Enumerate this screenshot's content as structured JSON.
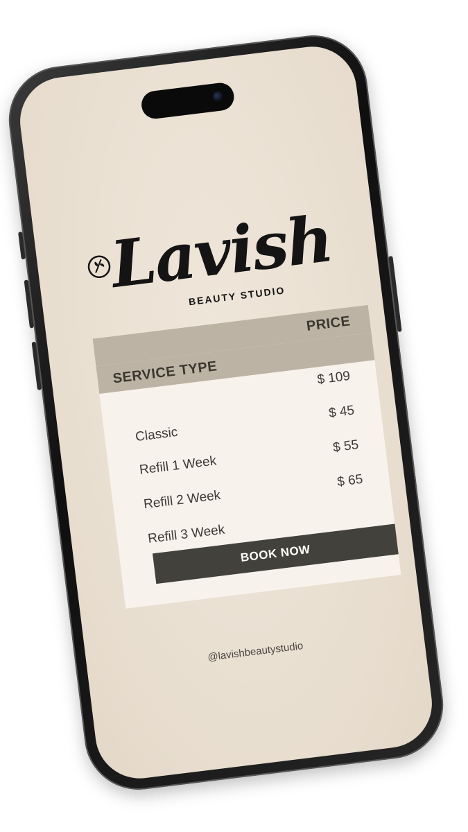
{
  "brand": {
    "name": "Lavish",
    "subtitle": "BEAUTY STUDIO"
  },
  "table": {
    "service_header": "SERVICE TYPE",
    "price_header": "PRICE",
    "rows": [
      {
        "service": "Classic",
        "price": "$ 109"
      },
      {
        "service": "Refill 1 Week",
        "price": "$ 45"
      },
      {
        "service": "Refill 2 Week",
        "price": "$ 55"
      },
      {
        "service": "Refill 3 Week",
        "price": "$ 65"
      }
    ]
  },
  "cta": {
    "label": "BOOK NOW"
  },
  "footer": {
    "handle": "@lavishbeautystudio"
  },
  "colors": {
    "screen_bg": "#e9dfd1",
    "header_bar": "#bcb3a4",
    "card_bg": "#f7f2ec",
    "button_bg": "#43413b",
    "text": "#3e3a35"
  },
  "icons": [
    "leaf-icon",
    "camera-icon"
  ]
}
